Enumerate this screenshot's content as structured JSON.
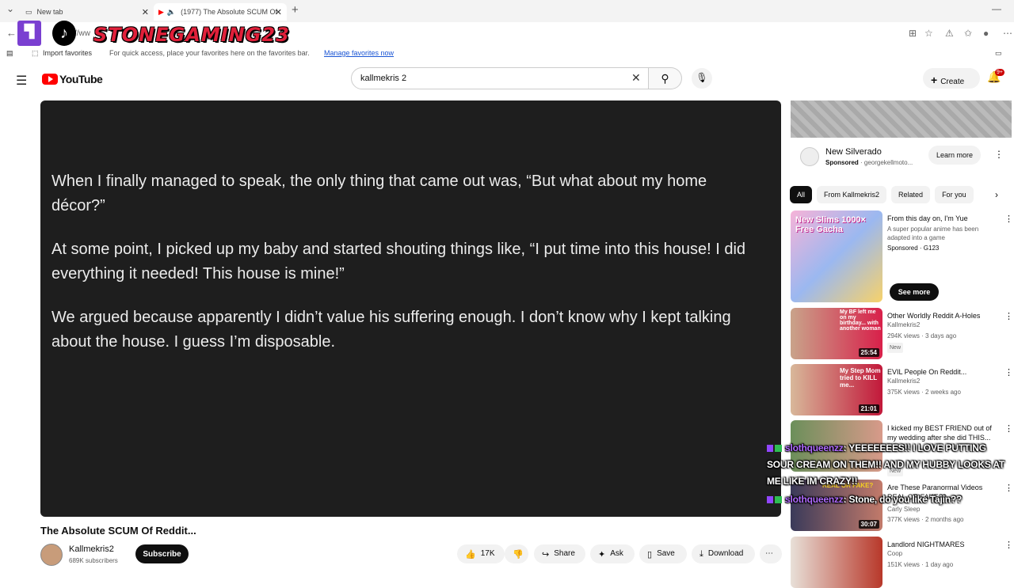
{
  "browser": {
    "tabs": [
      {
        "label": "New tab"
      },
      {
        "label": "(1977) The Absolute SCUM Of"
      }
    ],
    "address_partial": "//ww",
    "favorites": {
      "import_label": "Import favorites",
      "hint": "For quick access, place your favorites here on the favorites bar.",
      "manage_link": "Manage favorites now"
    }
  },
  "overlay": {
    "brand_text": "STONEGAMING23"
  },
  "youtube": {
    "logo_text": "YouTube",
    "search_value": "kallmekris 2",
    "create_label": "Create",
    "notif_count": "9+"
  },
  "video": {
    "paragraphs": [
      "When I finally managed to speak, the only thing that came out was, “But what about my home décor?”",
      "At some point, I picked up my baby and started shouting things like, “I put time into this house! I did everything it needed! This house is mine!”",
      "We argued because apparently I didn’t value his suffering enough. I don’t know why I kept talking about the house. I guess I’m disposable."
    ],
    "title": "The Absolute SCUM Of Reddit...",
    "channel": "Kallmekris2",
    "subscribers": "689K subscribers",
    "subscribe_label": "Subscribe",
    "likes": "17K",
    "share_label": "Share",
    "ask_label": "Ask",
    "save_label": "Save",
    "download_label": "Download"
  },
  "ad": {
    "title": "New Silverado",
    "sponsored": "Sponsored",
    "source": "georgekellmoto...",
    "cta": "Learn more"
  },
  "chips": [
    "All",
    "From Kallmekris2",
    "Related",
    "For you"
  ],
  "recommendations": [
    {
      "title": "From this day on, I'm Yue",
      "line1": "A super popular anime has been",
      "line2": "adapted into a game",
      "line3": "Sponsored · G123",
      "thumb_text": "New Slims 1000× Free Gacha",
      "see_more": "See more"
    },
    {
      "title": "Other Worldly Reddit A-Holes",
      "channel": "Kallmekris2",
      "stats": "294K views · 3 days ago",
      "badge": "New",
      "duration": "25:54",
      "thumb_text": "My BF left me on my birthday... with another woman"
    },
    {
      "title": "EVIL People On Reddit...",
      "channel": "Kallmekris2",
      "stats": "375K views · 2 weeks ago",
      "duration": "21:01",
      "thumb_text": "My Step Mom tried to KILL me..."
    },
    {
      "title": "I kicked my BEST FRIEND out of my wedding after she did THIS...",
      "channel": "",
      "stats": "",
      "badge": "New",
      "duration": "",
      "thumb_text": ""
    },
    {
      "title": "Are These Paranormal Videos REAL OR FAKE??",
      "channel": "Carly Sleep",
      "stats": "377K views · 2 months ago",
      "duration": "30:07",
      "thumb_text": "REAL OR FAKE?"
    },
    {
      "title": "Landlord NIGHTMARES",
      "channel": "Coop",
      "stats": "151K views · 1 day ago",
      "duration": "",
      "thumb_text": ""
    }
  ],
  "chat": [
    {
      "user": "slothqueenzz",
      "message": ": YEEEEEEES!! I LOVE PUTTING SOUR CREAM ON THEM!! AND MY HUBBY LOOKS AT ME LIKE IM CRAZY!!"
    },
    {
      "user": "slothqueenzz",
      "message": ": Stone, do you like Tajin??"
    }
  ]
}
